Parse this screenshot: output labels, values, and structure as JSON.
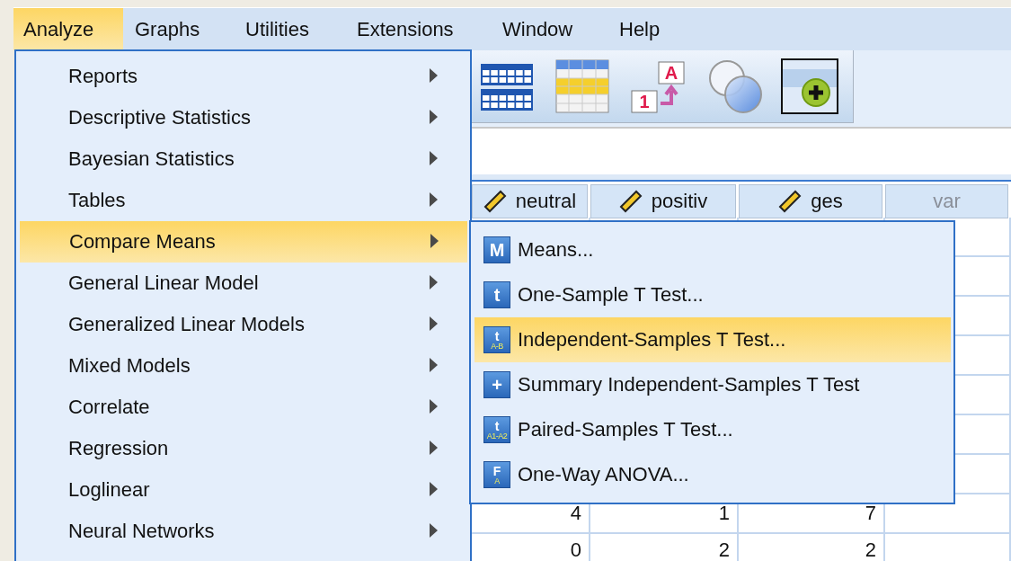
{
  "menubar": [
    {
      "label": "Analyze",
      "selected": true
    },
    {
      "label": "Graphs",
      "selected": false
    },
    {
      "label": "Utilities",
      "selected": false
    },
    {
      "label": "Extensions",
      "selected": false
    },
    {
      "label": "Window",
      "selected": false
    },
    {
      "label": "Help",
      "selected": false
    }
  ],
  "toolbar": [
    {
      "kind": "split-tables",
      "selected": false
    },
    {
      "kind": "grid",
      "selected": false
    },
    {
      "kind": "value-labels",
      "letters": [
        "A",
        "1"
      ],
      "selected": false
    },
    {
      "kind": "circles",
      "selected": false
    },
    {
      "kind": "add",
      "selected": true
    }
  ],
  "columns": [
    {
      "label": "neutral",
      "kind": "scale"
    },
    {
      "label": "positiv",
      "kind": "scale"
    },
    {
      "label": "ges",
      "kind": "scale"
    },
    {
      "label": "var",
      "kind": "empty"
    }
  ],
  "rows": [
    [
      "4",
      "1",
      "7"
    ],
    [
      "0",
      "2",
      "2"
    ]
  ],
  "menu": [
    {
      "label": "Reports",
      "selected": false
    },
    {
      "label": "Descriptive Statistics",
      "selected": false
    },
    {
      "label": "Bayesian Statistics",
      "selected": false
    },
    {
      "label": "Tables",
      "selected": false
    },
    {
      "label": "Compare Means",
      "selected": true
    },
    {
      "label": "General Linear Model",
      "selected": false
    },
    {
      "label": "Generalized Linear Models",
      "selected": false
    },
    {
      "label": "Mixed Models",
      "selected": false
    },
    {
      "label": "Correlate",
      "selected": false
    },
    {
      "label": "Regression",
      "selected": false
    },
    {
      "label": "Loglinear",
      "selected": false
    },
    {
      "label": "Neural Networks",
      "selected": false
    }
  ],
  "submenu": [
    {
      "label": "Means...",
      "badge": "M",
      "selected": false
    },
    {
      "label": "One-Sample T Test...",
      "badge": "t",
      "selected": false
    },
    {
      "label": "Independent-Samples T Test...",
      "badge": "t",
      "badge_sub": "A-B",
      "selected": true
    },
    {
      "label": "Summary Independent-Samples T Test",
      "badge": "+",
      "selected": false
    },
    {
      "label": "Paired-Samples T Test...",
      "badge": "t",
      "badge_sub": "A1-A2",
      "selected": false
    },
    {
      "label": "One-Way ANOVA...",
      "badge": "F",
      "badge_sub": "A",
      "selected": false
    }
  ]
}
